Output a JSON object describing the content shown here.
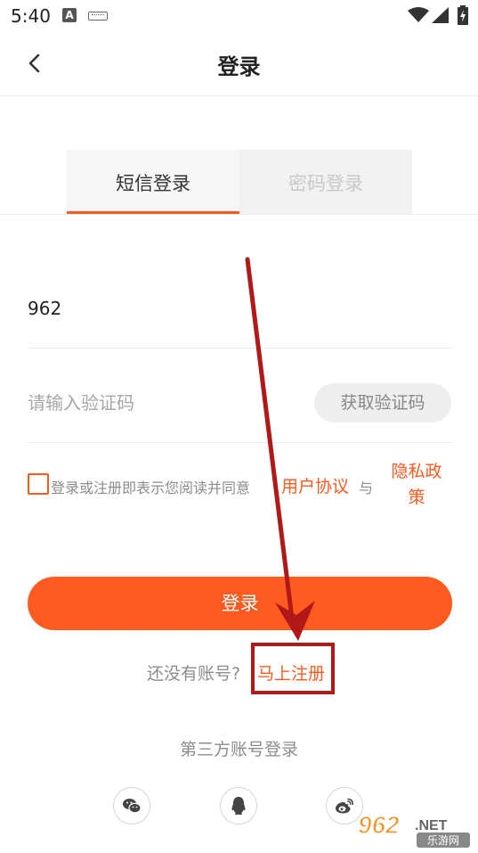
{
  "status_bar": {
    "time": "5:40",
    "notification_badge": "A",
    "icons": [
      "keyboard-icon",
      "wifi-icon",
      "signal-icon",
      "battery-icon"
    ]
  },
  "header": {
    "title": "登录",
    "back_icon": "chevron-left-icon"
  },
  "tabs": [
    {
      "label": "短信登录",
      "active": true
    },
    {
      "label": "密码登录",
      "active": false
    }
  ],
  "form": {
    "phone_value": "962",
    "code_placeholder": "请输入验证码",
    "get_code_label": "获取验证码"
  },
  "agreement": {
    "checked": false,
    "text": "登录或注册即表示您阅读并同意",
    "user_agreement": "用户协议",
    "and": "与",
    "privacy_line1": "隐私政",
    "privacy_line2": "策"
  },
  "login_button": "登录",
  "register": {
    "prompt": "还没有账号?",
    "link": "马上注册"
  },
  "third_party": {
    "title": "第三方账号登录",
    "providers": [
      "wechat-icon",
      "qq-icon",
      "weibo-icon"
    ]
  },
  "watermark": {
    "brand": "962",
    "suffix": ".NET",
    "tagline": "乐游网"
  },
  "colors": {
    "accent": "#ff5a1f",
    "annotation": "#b11818"
  }
}
